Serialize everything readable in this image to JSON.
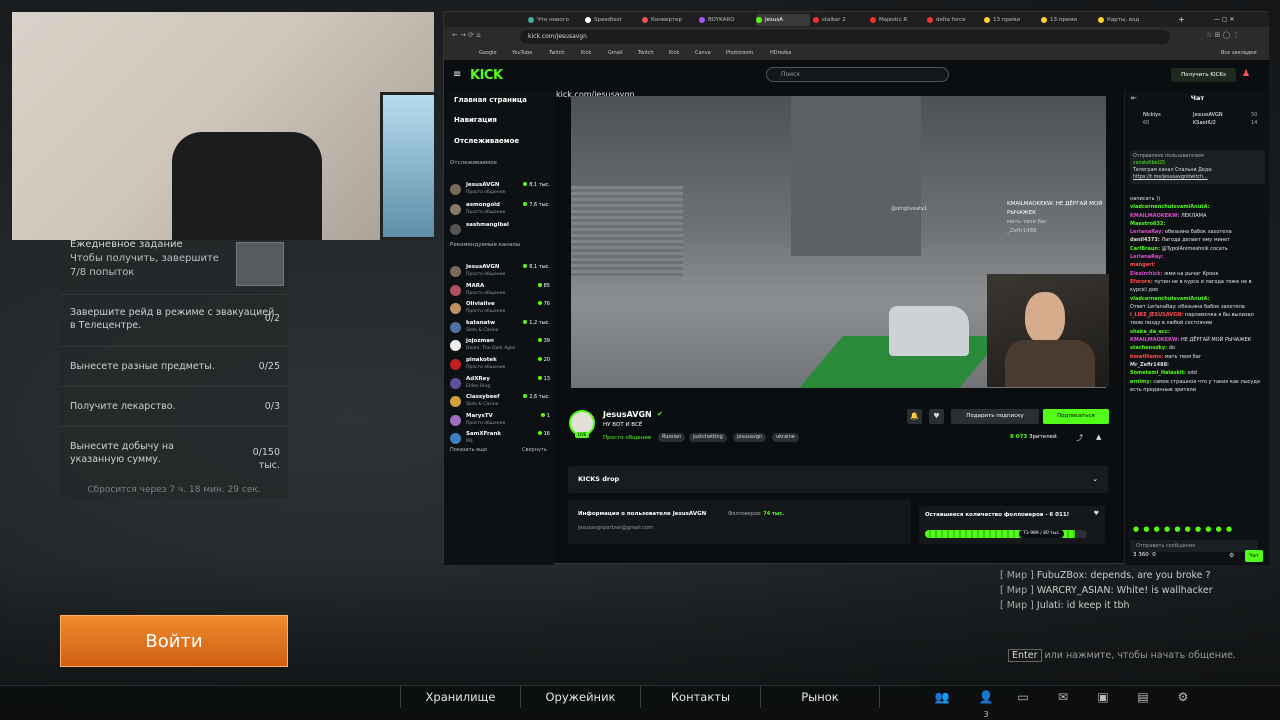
{
  "webcam": {
    "label": ""
  },
  "quests": {
    "title": "Ежедневное задание",
    "subtitle": "Чтобы получить, завершите 7/8 попыток",
    "rows": [
      {
        "text": "Завершите рейд в режиме с эвакуацией в Телецентре.",
        "count": "0/2"
      },
      {
        "text": "Вынесете разные предметы.",
        "count": "0/25"
      },
      {
        "text": "Получите лекарство.",
        "count": "0/3"
      },
      {
        "text": "Вынесите добычу на указанную сумму.",
        "count": "0/150 тыс."
      }
    ],
    "reset": "Сбросится через 7 ч. 18 мин. 29 сек."
  },
  "login_button": "Войти",
  "game_chat": {
    "lines": [
      {
        "ch": "[ Мир ]",
        "user": "FubuZBox:",
        "text": "depends, are you broke ?"
      },
      {
        "ch": "[ Мир ]",
        "user": "WARCRY_ASIAN:",
        "text": "White! is wallhacker"
      },
      {
        "ch": "[ Мир ]",
        "user": "Julati:",
        "text": "id keep it tbh"
      }
    ],
    "hint_key": "Enter",
    "hint": "или нажмите, чтобы начать общение."
  },
  "bottom_nav": {
    "storage": "Хранилище",
    "armory": "Оружейник",
    "contacts": "Контакты",
    "market": "Рынок",
    "squad_count": "3"
  },
  "browser": {
    "tabs": [
      "Что нового",
      "Speedtest",
      "Конвертер",
      "BOYKARO",
      "JesusA",
      "stalker 2",
      "Majestic R",
      "delta force",
      "13 преми",
      "13 преми",
      "Карты, вод"
    ],
    "address": "kick.com/jesusavgn",
    "bookmarks": [
      "Google",
      "YouTube",
      "Twitch",
      "Kick",
      "Gmail",
      "Twitch",
      "Kick",
      "Canva",
      "Photoroom",
      "HDrezka",
      "Все закладки"
    ]
  },
  "kick": {
    "logo": "KICK",
    "search_placeholder": "Поиск",
    "get_kicks": "Получить KICKs",
    "nav": {
      "home": "Главная страница",
      "browse": "Навигация",
      "following": "Отслеживаемое"
    },
    "following_label": "Отслеживаемое",
    "following": [
      {
        "name": "JesusAVGN",
        "cat": "Просто общение",
        "viewers": "8,1 тыс.",
        "color": "#7a6a5a"
      },
      {
        "name": "asmongold",
        "cat": "Просто общение",
        "viewers": "7,6 тыс.",
        "color": "#8a7a6a"
      },
      {
        "name": "sashmangibal",
        "cat": "",
        "viewers": "",
        "color": "#555"
      }
    ],
    "recommended_label": "Рекомендуемые каналы",
    "recommended": [
      {
        "name": "JesusAVGN",
        "cat": "Просто общение",
        "viewers": "8,1 тыс.",
        "color": "#7a6a5a"
      },
      {
        "name": "MARA",
        "cat": "Просто общение",
        "viewers": "85",
        "color": "#b05060"
      },
      {
        "name": "Olivialive",
        "cat": "Просто общение",
        "viewers": "76",
        "color": "#c09060"
      },
      {
        "name": "katanatw",
        "cat": "Slots & Casino",
        "viewers": "1,2 тыс.",
        "color": "#5070a0"
      },
      {
        "name": "jojozman",
        "cat": "Doom: The Dark Ages",
        "viewers": "39",
        "color": "#eee"
      },
      {
        "name": "pinakotek",
        "cat": "Просто общение",
        "viewers": "20",
        "color": "#c02020"
      },
      {
        "name": "AdXRey",
        "cat": "Elden Ring",
        "viewers": "13",
        "color": "#6050a0"
      },
      {
        "name": "Classybeef",
        "cat": "Slots & Casino",
        "viewers": "2,6 тыс.",
        "color": "#d0a040"
      },
      {
        "name": "MarysTV",
        "cat": "Просто общение",
        "viewers": "1",
        "color": "#a070c0"
      },
      {
        "name": "SamXFrank",
        "cat": "IRL",
        "viewers": "16",
        "color": "#4080c0"
      }
    ],
    "show_more": "Показать еще",
    "collapse": "Свернуть",
    "url_overlay": "kick.com/jesusavgn",
    "stream_overlay": {
      "line1": "KMAILMAOKEKW: НЕ ДЁРГАЙ МОЙ РЫЧАЖЕК",
      "line2": "мать твоя баг",
      "line3": "_Zefir1488",
      "watermark": "@omgliveatv1"
    },
    "channel": {
      "name": "JesusAVGN",
      "title": "НУ ВОТ И ВСЁ",
      "category": "Просто общение",
      "tags": [
        "Russian",
        "justchatting",
        "jesusavgn",
        "ukraine"
      ],
      "live": "LIVE"
    },
    "gift_sub": "Подарить подписку",
    "subscribe": "Подписаться",
    "viewers": "8 073",
    "viewers_label": "Зрителей",
    "kicks_drop": "KICKS drop",
    "about": {
      "title": "Информация о пользователе JesusAVGN",
      "followers_label": "Фолловеров:",
      "followers": "74 тыс.",
      "email": "jesusavgnpartner@gmail.com"
    },
    "goal": {
      "title": "Оставшееся количество фолловеров - 6 011!",
      "progress_label": "73 989 / 80 тыс.",
      "progress": 0.925
    }
  },
  "chat": {
    "title": "Чат",
    "top_gifters": [
      {
        "name": "Nickiys",
        "n": "60"
      },
      {
        "name": "JesussAVGN",
        "n": "50"
      },
      {
        "name": "KSaotIU2",
        "n": "14"
      }
    ],
    "pinned": {
      "label": "Отправлено пользователем",
      "user": "constellbel25",
      "text": "Телеграм канал Спальни Деда:",
      "link": "https://t.me/jesusavgnitwitch..."
    },
    "messages": [
      {
        "user": "",
        "text": "написать ))",
        "color": "#ddd"
      },
      {
        "user": "vladcernenchutsvamiAnutA:",
        "text": "",
        "color": "#53fc18"
      },
      {
        "user": "KMAILMAOKEKW:",
        "text": "ЛЕКЛАМА",
        "color": "#e04fcf"
      },
      {
        "user": "Maestro832:",
        "text": "",
        "color": "#53fc18"
      },
      {
        "user": "LerlanaRay:",
        "text": "обезьяна бабок захотела",
        "color": "#e04fcf"
      },
      {
        "user": "danil4373:",
        "text": "Лагода делает ему минет",
        "color": "#ddd"
      },
      {
        "user": "CarlBraun:",
        "text": "@TypoIAnimeshnik сосать",
        "color": "#53fc18"
      },
      {
        "user": "LerlanaRay:",
        "text": "",
        "color": "#e04fcf"
      },
      {
        "user": "mangeri:",
        "text": "",
        "color": "#ff5050"
      },
      {
        "user": "Elexirchick:",
        "text": "жми на рычаг Кронк",
        "color": "#e04fcf"
      },
      {
        "user": "Eforore:",
        "text": "путин не в курсе и лагода тоже не в курсе) доо",
        "color": "#ff5050"
      },
      {
        "user": "vladcernenchutsvamiAnutA:",
        "text": "",
        "color": "#53fc18"
      },
      {
        "user": "",
        "text": "Ответ LerlanaRay: обезьяна бабок захотела",
        "color": "#888"
      },
      {
        "user": "I_LIKE_JESUSAVGN:",
        "text": "парламочка я бы вылизал твою пизду в любой состоянии",
        "color": "#ff5050"
      },
      {
        "user": "shaka_da_acc:",
        "text": "",
        "color": "#53fc18"
      },
      {
        "user": "KMAILMAOKEKW:",
        "text": "НЕ ДЁРГАЙ МОЙ РЫЧАЖЕК",
        "color": "#e04fcf"
      },
      {
        "user": "stachenozky:",
        "text": "do",
        "color": "#53fc18"
      },
      {
        "user": "bwwilliams:",
        "text": "мать твоя баг",
        "color": "#ff5050"
      },
      {
        "user": "Mr_Zefir1488:",
        "text": "",
        "color": "#ddd"
      },
      {
        "user": "Someteml_Halaskit:",
        "text": "xdd",
        "color": "#53fc18"
      },
      {
        "user": "ernimy:",
        "text": "самое страшное что у таких как лысуда есть преданные зрители",
        "color": "#53fc18"
      }
    ],
    "input_placeholder": "Отправить сообщение",
    "kicks": "3 360",
    "zero": "0",
    "send": "Чат"
  }
}
